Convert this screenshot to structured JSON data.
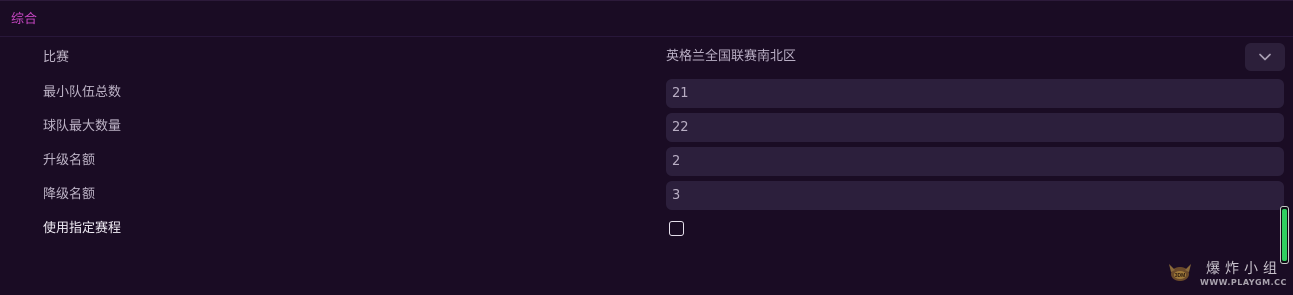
{
  "section": {
    "title": "综合"
  },
  "rows": [
    {
      "label": "比赛",
      "control": "dropdown",
      "value": "英格兰全国联赛南北区"
    },
    {
      "label": "最小队伍总数",
      "control": "text",
      "value": "21"
    },
    {
      "label": "球队最大数量",
      "control": "text",
      "value": "22"
    },
    {
      "label": "升级名额",
      "control": "text",
      "value": "2"
    },
    {
      "label": "降级名额",
      "control": "text",
      "value": "3"
    },
    {
      "label": "使用指定赛程",
      "control": "checkbox",
      "checked": false
    }
  ],
  "icons": {
    "dropdown": "chevron-down-icon",
    "watermark_logo": "3dm-logo-icon"
  },
  "watermark": {
    "title": "爆炸小组",
    "url": "WWW.PLAYGM.CC"
  },
  "colors": {
    "background": "#1a0c24",
    "section_title": "#c646c2",
    "field_bg": "#2c1f3c",
    "scroll_thumb": "#2fcf60"
  }
}
